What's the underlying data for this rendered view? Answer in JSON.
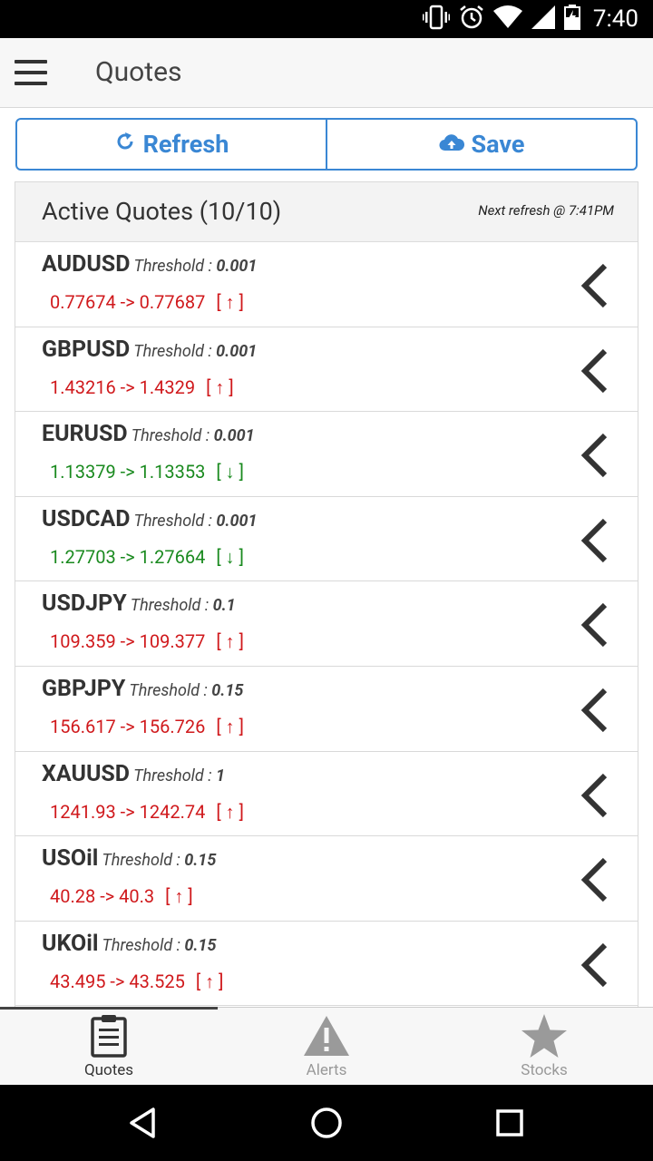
{
  "status_bar": {
    "time": "7:40"
  },
  "header": {
    "title": "Quotes"
  },
  "toolbar": {
    "refresh_label": "Refresh",
    "save_label": "Save"
  },
  "list": {
    "title": "Active Quotes (10/10)",
    "next_refresh": "Next refresh @ 7:41PM",
    "threshold_label": "Threshold : ",
    "items": [
      {
        "symbol": "AUDUSD",
        "threshold": "0.001",
        "change": "0.77674 -> 0.77687",
        "direction": "[ ↑ ]",
        "trend": "up"
      },
      {
        "symbol": "GBPUSD",
        "threshold": "0.001",
        "change": "1.43216 -> 1.4329",
        "direction": "[ ↑ ]",
        "trend": "up"
      },
      {
        "symbol": "EURUSD",
        "threshold": "0.001",
        "change": "1.13379 -> 1.13353",
        "direction": "[ ↓ ]",
        "trend": "down"
      },
      {
        "symbol": "USDCAD",
        "threshold": "0.001",
        "change": "1.27703 -> 1.27664",
        "direction": "[ ↓ ]",
        "trend": "down"
      },
      {
        "symbol": "USDJPY",
        "threshold": "0.1",
        "change": "109.359 -> 109.377",
        "direction": "[ ↑ ]",
        "trend": "up"
      },
      {
        "symbol": "GBPJPY",
        "threshold": "0.15",
        "change": "156.617 -> 156.726",
        "direction": "[ ↑ ]",
        "trend": "up"
      },
      {
        "symbol": "XAUUSD",
        "threshold": "1",
        "change": "1241.93 -> 1242.74",
        "direction": "[ ↑ ]",
        "trend": "up"
      },
      {
        "symbol": "USOil",
        "threshold": "0.15",
        "change": "40.28 -> 40.3",
        "direction": "[ ↑ ]",
        "trend": "up"
      },
      {
        "symbol": "UKOil",
        "threshold": "0.15",
        "change": "43.495 -> 43.525",
        "direction": "[ ↑ ]",
        "trend": "up"
      }
    ]
  },
  "tabs": [
    {
      "label": "Quotes",
      "icon": "clipboard-icon",
      "active": true
    },
    {
      "label": "Alerts",
      "icon": "warning-icon",
      "active": false
    },
    {
      "label": "Stocks",
      "icon": "star-icon",
      "active": false
    }
  ],
  "colors": {
    "accent": "#3a87d4",
    "up": "#d0191c",
    "down": "#1a8a1f"
  }
}
